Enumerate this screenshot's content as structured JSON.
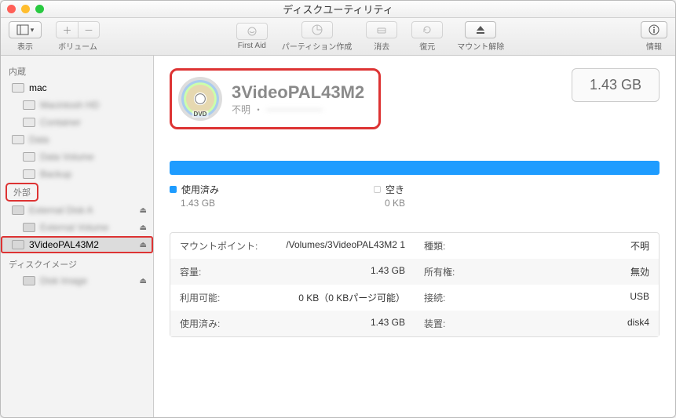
{
  "window": {
    "title": "ディスクユーティリティ"
  },
  "toolbar": {
    "view_label": "表示",
    "volume_label": "ボリューム",
    "firstaid_label": "First Aid",
    "partition_label": "パーティション作成",
    "erase_label": "消去",
    "restore_label": "復元",
    "unmount_label": "マウント解除",
    "info_label": "情報"
  },
  "sidebar": {
    "internal_heading": "内蔵",
    "external_heading": "外部",
    "diskimage_heading": "ディスクイメージ",
    "internal": [
      {
        "name": "mac",
        "blur": false
      },
      {
        "name": "Macintosh HD",
        "blur": true,
        "child": true
      },
      {
        "name": "Container",
        "blur": true,
        "child": true
      },
      {
        "name": "Data",
        "blur": true
      },
      {
        "name": "Data Volume",
        "blur": true,
        "child": true
      },
      {
        "name": "Backup",
        "blur": true,
        "child": true
      }
    ],
    "external": [
      {
        "name": "External Disk A",
        "blur": true,
        "eject": true
      },
      {
        "name": "External Volume",
        "blur": true,
        "child": true,
        "eject": true
      },
      {
        "name": "3VideoPAL43M2",
        "blur": false,
        "selected": true,
        "highlight": true,
        "eject": true
      }
    ],
    "diskimages": [
      {
        "name": "Disk Image",
        "blur": true,
        "child": true,
        "eject": true
      }
    ]
  },
  "volume": {
    "name": "3VideoPAL43M2",
    "subtype": "不明",
    "sub_blurred": "——————",
    "size": "1.43 GB"
  },
  "usage": {
    "used_label": "使用済み",
    "used_value": "1.43 GB",
    "free_label": "空き",
    "free_value": "0 KB"
  },
  "details": {
    "rows": [
      {
        "k1": "マウントポイント:",
        "v1": "/Volumes/3VideoPAL43M2 1",
        "k2": "種類:",
        "v2": "不明"
      },
      {
        "k1": "容量:",
        "v1": "1.43 GB",
        "k2": "所有権:",
        "v2": "無効"
      },
      {
        "k1": "利用可能:",
        "v1": "0 KB（0 KBパージ可能）",
        "k2": "接続:",
        "v2": "USB"
      },
      {
        "k1": "使用済み:",
        "v1": "1.43 GB",
        "k2": "装置:",
        "v2": "disk4"
      }
    ]
  }
}
